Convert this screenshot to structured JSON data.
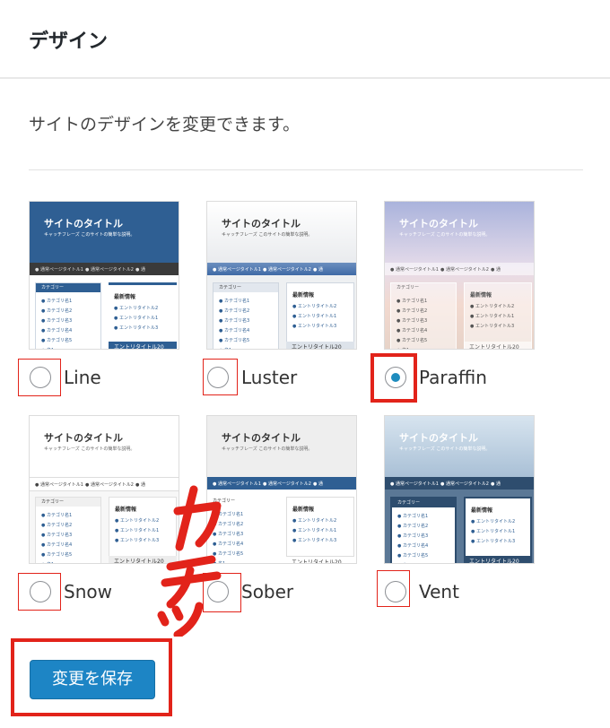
{
  "header": {
    "title": "デザイン"
  },
  "description": "サイトのデザインを変更できます。",
  "preview": {
    "site_title": "サイトのタイトル",
    "catchphrase": "キャッチフレーズ このサイトの簡単な説明。",
    "nav_items": [
      "● 通常ページタイトル1",
      "● 通常ページタイトル2",
      "● 通"
    ],
    "category_head": "カテゴリー",
    "categories": [
      "● カテゴリ名1",
      "● カテゴリ名2",
      "● カテゴリ名3",
      "● カテゴリ名4",
      "● カテゴリ名5",
      "● 名1"
    ],
    "latest_head": "最新情報",
    "entries": [
      "● エントリタイトル2",
      "● エントリタイトル1",
      "● エントリタイトル3"
    ],
    "footer_entry": "エントリタイトル20"
  },
  "designs": [
    {
      "name": "Line",
      "selected": false
    },
    {
      "name": "Luster",
      "selected": false
    },
    {
      "name": "Paraffin",
      "selected": true
    },
    {
      "name": "Snow",
      "selected": false
    },
    {
      "name": "Sober",
      "selected": false
    },
    {
      "name": "Vent",
      "selected": false
    }
  ],
  "save_button": "変更を保存",
  "annotation_color": "#e2231a",
  "accent_color": "#1d85c5"
}
